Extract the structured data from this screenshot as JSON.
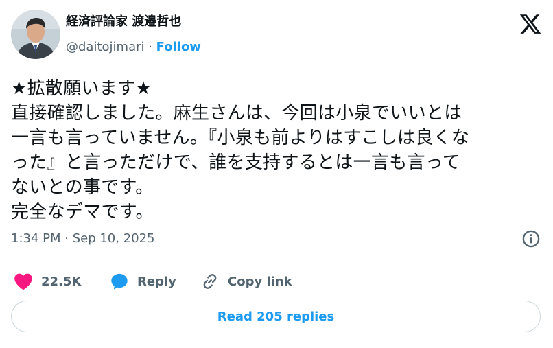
{
  "author": {
    "display_name": "経済評論家 渡邉哲也",
    "handle": "@daitojimari",
    "separator": " · ",
    "follow_label": "Follow"
  },
  "tweet": {
    "lines": [
      "★拡散願います★",
      "直接確認しました。麻生さんは、今回は小泉でいいとは",
      "一言も言っていません。『小泉も前よりはすこしは良くな",
      "った』と言っただけで、誰を支持するとは一言も言って",
      "ないとの事です。",
      "完全なデマです。"
    ],
    "timestamp": "1:34 PM · Sep 10, 2025"
  },
  "actions": {
    "likes_count": "22.5K",
    "reply_label": "Reply",
    "copy_link_label": "Copy link"
  },
  "read_replies_label": "Read 205 replies",
  "icons": {
    "brand": "x-logo-icon",
    "info": "info-icon",
    "like": "heart-icon",
    "reply": "reply-bubble-icon",
    "copy": "link-icon"
  },
  "colors": {
    "text": "#0f1419",
    "secondary": "#536471",
    "accent": "#1d9bf0",
    "like": "#f91880",
    "border": "#cfd9de"
  }
}
